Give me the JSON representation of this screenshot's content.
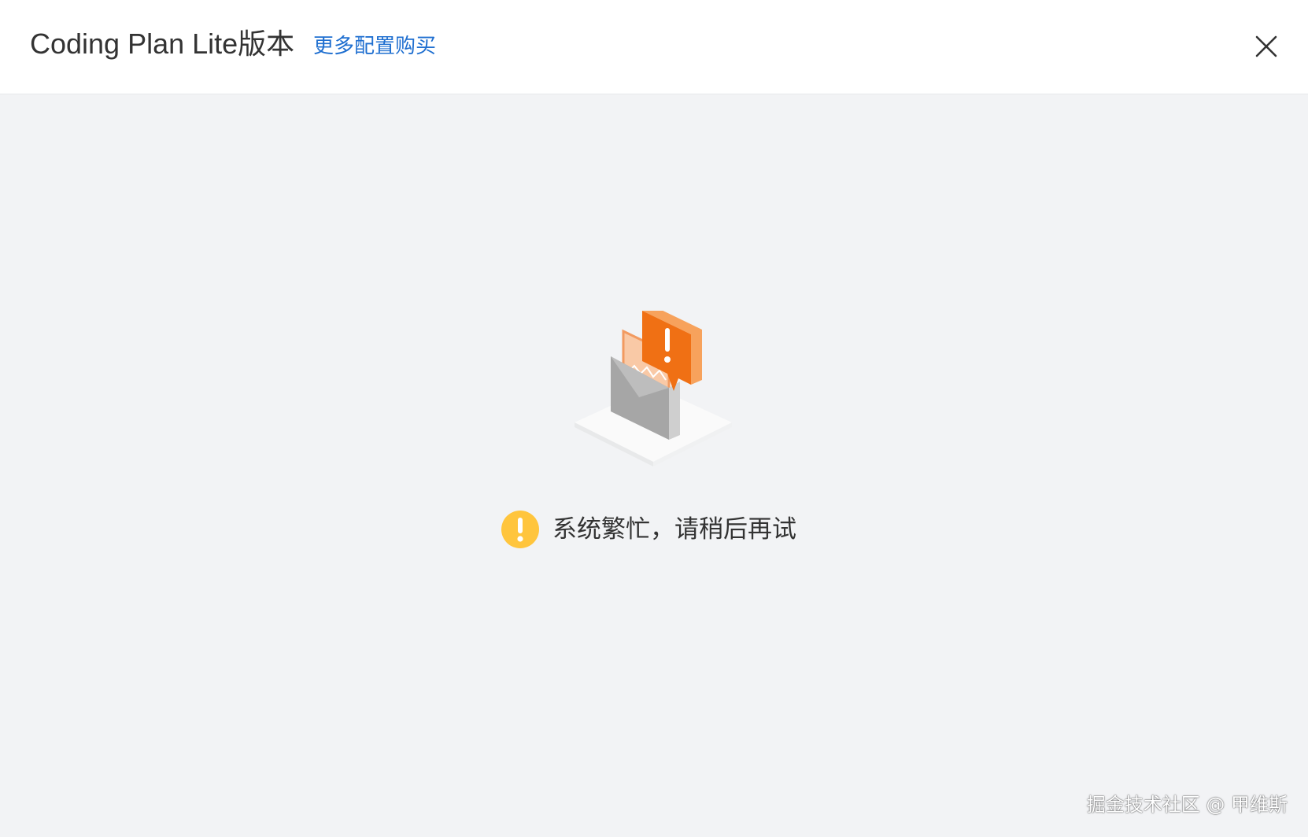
{
  "header": {
    "title": "Coding Plan Lite版本",
    "more_link": "更多配置购买",
    "close_icon": "close-icon"
  },
  "main": {
    "illustration_icon": "error-document-icon",
    "status_icon": "warning-circle-icon",
    "message": "系统繁忙，请稍后再试"
  },
  "watermark": {
    "text": "掘金技术社区 @ 甲维斯"
  },
  "colors": {
    "link": "#1f6fd0",
    "background": "#f2f3f5",
    "warning": "#ffc53d",
    "accent": "#f07014"
  }
}
